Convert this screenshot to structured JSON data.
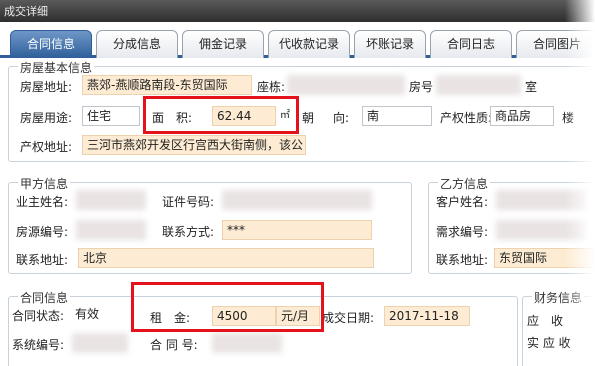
{
  "window": {
    "title": "成交详细"
  },
  "tabs": [
    {
      "label": "合同信息",
      "active": true
    },
    {
      "label": "分成信息",
      "active": false
    },
    {
      "label": "佣金记录",
      "active": false
    },
    {
      "label": "代收款记录",
      "active": false
    },
    {
      "label": "坏账记录",
      "active": false
    },
    {
      "label": "合同日志",
      "active": false
    },
    {
      "label": "合同图片",
      "active": false
    }
  ],
  "house": {
    "legend": "房屋基本信息",
    "address_label": "房屋地址:",
    "address_value": "燕郊-燕顺路南段-东贸国际",
    "building_label": "座栋:",
    "room_label": "房号",
    "room_suffix": "室",
    "use_label": "房屋用途:",
    "use_value": "住宅",
    "area_label": "面　积:",
    "area_value": "62.44",
    "area_unit": "㎡",
    "orient_label1": "朝",
    "orient_label2": "向:",
    "orient_value": "南",
    "property_label": "产权性质:",
    "property_value": "商品房",
    "floor_label": "楼",
    "deed_label": "产权地址:",
    "deed_value": "三河市燕郊开发区行宫西大街南侧，该公"
  },
  "party_a": {
    "legend": "甲方信息",
    "owner_label": "业主姓名:",
    "id_label": "证件号码:",
    "source_label": "房源编号:",
    "contact_label": "联系方式:",
    "contact_value": "***",
    "addr_label": "联系地址:",
    "addr_value": "北京"
  },
  "party_b": {
    "legend": "乙方信息",
    "client_label": "客户姓名:",
    "demand_label": "需求编号:",
    "addr_label": "联系地址:",
    "addr_value": "东贸国际"
  },
  "contract": {
    "legend": "合同信息",
    "status_label": "合同状态:",
    "status_value": "有效",
    "rent_label": "租　金:",
    "rent_value": "4500",
    "rent_unit": "元/月",
    "deal_date_label": "成交日期:",
    "deal_date_value": "2017-11-18",
    "sysno_label": "系统编号:",
    "contract_no_label": "合 同 号:"
  },
  "finance": {
    "legend": "财务信息",
    "receivable_label": "应　收",
    "received_label": "实 应 收"
  },
  "colors": {
    "highlight": "#e4131b",
    "active_tab": "#2e5f99",
    "field_bg": "#fdecd3"
  }
}
